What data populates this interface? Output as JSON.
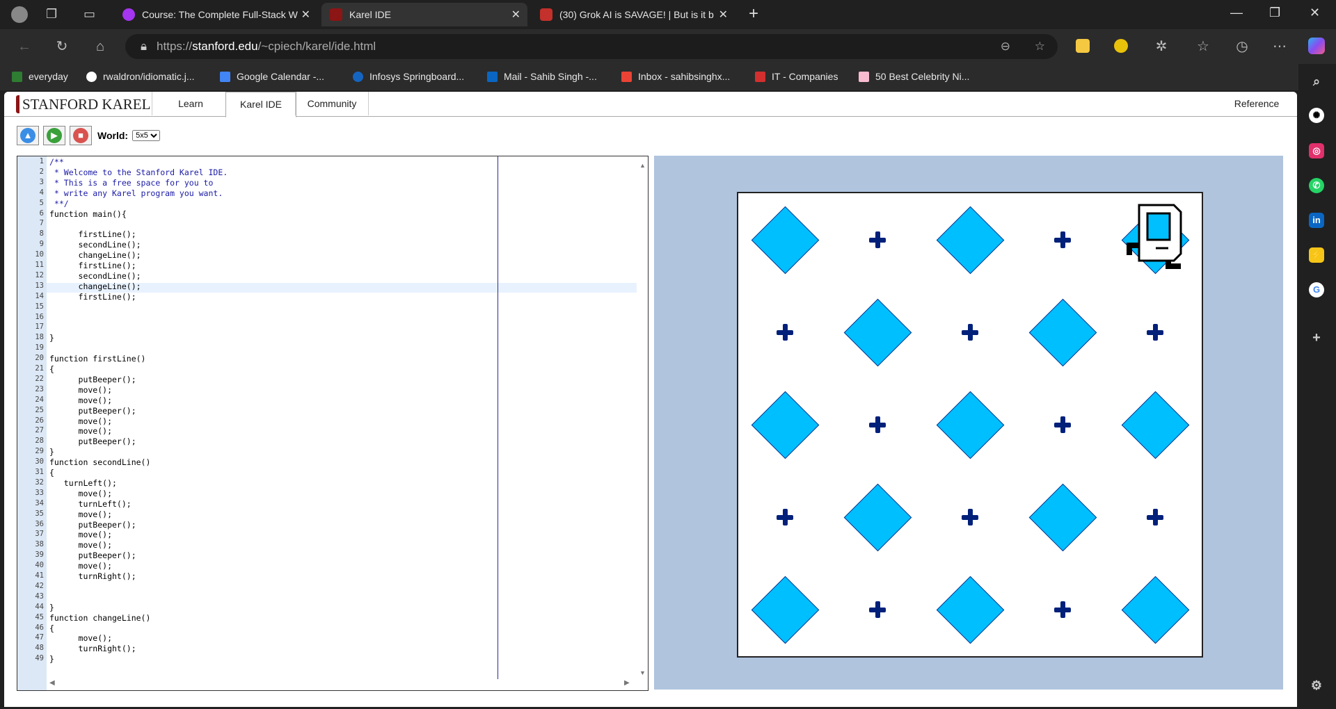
{
  "browser": {
    "tabs": [
      {
        "title": "Course: The Complete Full-Stack W",
        "icon": "udemy-icon",
        "active": false
      },
      {
        "title": "Karel IDE",
        "icon": "stanford-icon",
        "active": true
      },
      {
        "title": "(30) Grok AI is SAVAGE! | But is it b",
        "icon": "youtube-icon",
        "active": false
      }
    ],
    "url_prefix": "https://",
    "url_host": "stanford.edu",
    "url_path": "/~cpiech/karel/ide.html",
    "bookmarks": [
      {
        "label": "everyday",
        "color": "#2e7d32"
      },
      {
        "label": "rwaldron/idiomatic.j...",
        "color": "#ffffff"
      },
      {
        "label": "Google Calendar -...",
        "color": "#4285f4"
      },
      {
        "label": "Infosys Springboard...",
        "color": "#1565c0"
      },
      {
        "label": "Mail - Sahib Singh -...",
        "color": "#0a66c2"
      },
      {
        "label": "Inbox - sahibsinghx...",
        "color": "#ea4335"
      },
      {
        "label": "IT - Companies",
        "color": "#d32f2f"
      },
      {
        "label": "50 Best Celebrity Ni...",
        "color": "#f8bbd0"
      }
    ]
  },
  "karel": {
    "logo": "STANFORD KAREL",
    "nav_tabs": [
      "Learn",
      "Karel IDE",
      "Community"
    ],
    "reference": "Reference",
    "world_label": "World:",
    "world_value": "5x5"
  },
  "code_lines": [
    "/**",
    " * Welcome to the Stanford Karel IDE.",
    " * This is a free space for you to",
    " * write any Karel program you want.",
    " **/",
    "function main(){",
    "",
    "      firstLine();",
    "      secondLine();",
    "      changeLine();",
    "      firstLine();",
    "      secondLine();",
    "      changeLine();",
    "      firstLine();",
    "",
    "",
    "",
    "}",
    "",
    "function firstLine()",
    "{",
    "      putBeeper();",
    "      move();",
    "      move();",
    "      putBeeper();",
    "      move();",
    "      move();",
    "      putBeeper();",
    "}",
    "function secondLine()",
    "{",
    "   turnLeft();",
    "      move();",
    "      turnLeft();",
    "      move();",
    "      putBeeper();",
    "      move();",
    "      move();",
    "      putBeeper();",
    "      move();",
    "      turnRight();",
    "",
    "",
    "}",
    "function changeLine()",
    "{",
    "      move();",
    "      turnRight();",
    "}"
  ],
  "line_numbers": [
    "1",
    "2",
    "3",
    "4",
    "5",
    "6",
    "7",
    "8",
    "9",
    "10",
    "11",
    "12",
    "13",
    "14",
    "15",
    "16",
    "17",
    "18",
    "19",
    "20",
    "21",
    "22",
    "23",
    "24",
    "25",
    "26",
    "27",
    "28",
    "29",
    "30",
    "31",
    "32",
    "33",
    "34",
    "35",
    "36",
    "37",
    "38",
    "39",
    "40",
    "41",
    "42",
    "43",
    "44",
    "45",
    "46",
    "47",
    "48",
    "49"
  ],
  "world": {
    "size": 5,
    "beepers": [
      [
        1,
        5
      ],
      [
        3,
        5
      ],
      [
        5,
        5
      ],
      [
        2,
        4
      ],
      [
        4,
        4
      ],
      [
        1,
        3
      ],
      [
        3,
        3
      ],
      [
        5,
        3
      ],
      [
        2,
        2
      ],
      [
        4,
        2
      ],
      [
        1,
        1
      ],
      [
        3,
        1
      ],
      [
        5,
        1
      ]
    ],
    "karel": [
      5,
      5
    ]
  }
}
